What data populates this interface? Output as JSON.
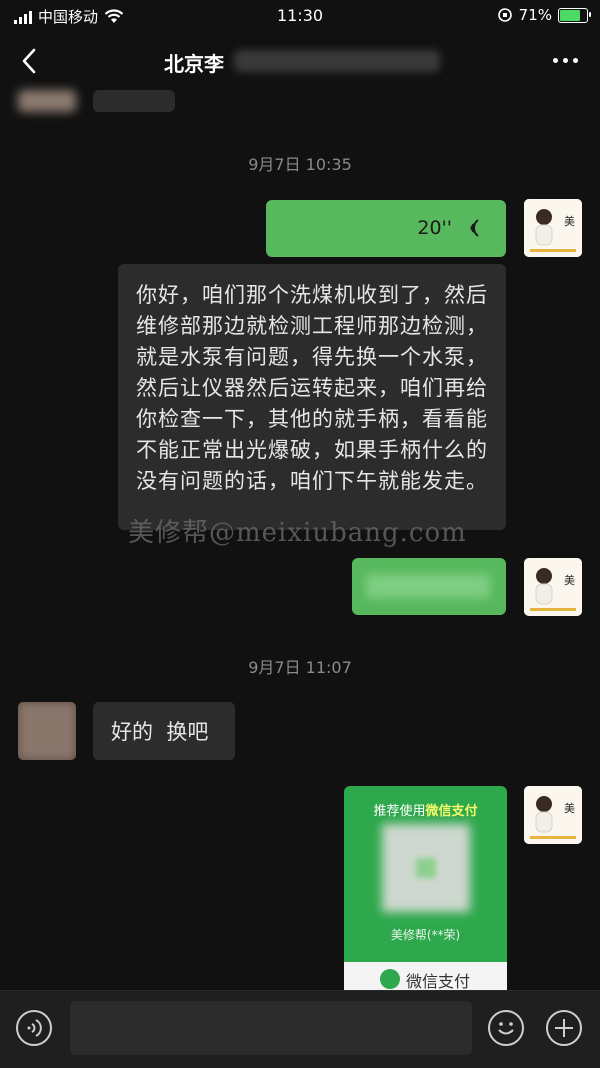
{
  "status_bar": {
    "carrier": "中国移动",
    "time": "11:30",
    "battery": "71%"
  },
  "nav": {
    "title": "北京李",
    "back_icon": "chevron-left-icon",
    "more_icon": "more-dots-icon"
  },
  "messages": {
    "timestamp_1": "9月7日 10:35",
    "voice_duration": "20''",
    "transcript": "你好，咱们那个洗煤机收到了，然后维修部那边就检测工程师那边检测，就是水泵有问题，得先换一个水泵，然后让仪器然后运转起来，咱们再给你检查一下，其他的就手柄，看看能不能正常出光爆破，如果手柄什么的没有问题的话，咱们下午就能发走。",
    "timestamp_2": "9月7日 11:07",
    "reply": "好的  换吧"
  },
  "watermark": "美修帮@meixiubang.com",
  "payment_card": {
    "header_prefix": "推荐使用",
    "header_brand": "微信支付",
    "payee": "美修帮(**荣)",
    "footer": "微信支付"
  },
  "colors": {
    "background": "#111111",
    "bubble_green": "#57b85d",
    "bubble_gray": "#2c2c2c",
    "pay_green": "#2ea84c"
  }
}
